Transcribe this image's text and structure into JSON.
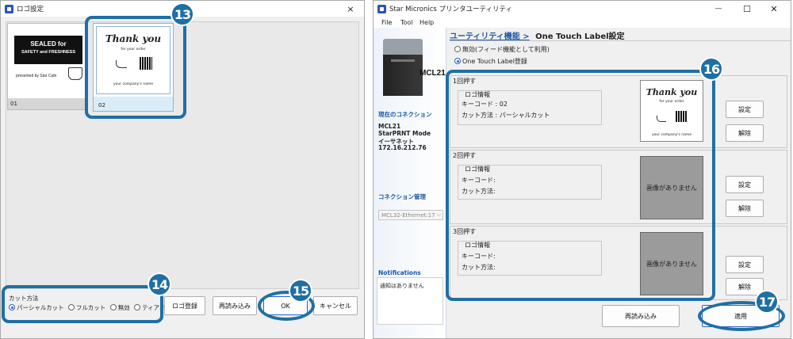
{
  "left_window": {
    "title": "ロゴ設定",
    "close": "×",
    "logos": [
      {
        "index": "01",
        "line1": "SEALED for",
        "line2": "SAFETY and FRESHNESS",
        "line3": "presented by Star Cafe"
      },
      {
        "index": "02",
        "title": "Thank you",
        "line1": "for your order",
        "line2": "your company's name"
      }
    ],
    "cut_method": {
      "label": "カット方法",
      "options": [
        "パーシャルカット",
        "フルカット",
        "無効",
        "ティアオフ"
      ],
      "selected": "パーシャルカット"
    },
    "buttons": {
      "register": "ロゴ登録",
      "reload": "再読み込み",
      "ok": "OK",
      "cancel": "キャンセル"
    }
  },
  "right_window": {
    "title": "Star Micronics プリンタユーティリティ",
    "controls": {
      "minimize": "—",
      "maximize": "☐",
      "close": "✕"
    },
    "menu": [
      "File",
      "Tool",
      "Help"
    ],
    "breadcrumb": {
      "parent": "ユーティリティ機能 >",
      "current": "One Touch Label設定"
    },
    "mode_options": [
      {
        "label": "無効(フィード機能として利用)",
        "selected": false
      },
      {
        "label": "One Touch Label登録",
        "selected": true
      }
    ],
    "printer": {
      "model_label": "MCL21"
    },
    "sidebar": {
      "conn_title": "現在のコネクション",
      "conn_lines": [
        "MCL21",
        "StarPRNT Mode",
        "イーサネット",
        "172.16.212.76"
      ],
      "conn_mgmt": "コネクション管理",
      "conn_select": "MCL32-Ethernet:17",
      "notif_title": "Notifications",
      "notif_text": "通知はありません"
    },
    "presses": [
      {
        "header": "1回押す",
        "info_title": "ロゴ情報",
        "key_code": "キーコード : 02",
        "cut": "カット方法 : パーシャルカット",
        "has_image": true
      },
      {
        "header": "2回押す",
        "info_title": "ロゴ情報",
        "key_code": "キーコード:",
        "cut": "カット方法:",
        "has_image": false,
        "no_image": "画像がありません"
      },
      {
        "header": "3回押す",
        "info_title": "ロゴ情報",
        "key_code": "キーコード:",
        "cut": "カット方法:",
        "has_image": false,
        "no_image": "画像がありません"
      }
    ],
    "preview": {
      "title": "Thank you",
      "line1": "for your order",
      "line2": "your company's name"
    },
    "side_buttons": {
      "set": "設定",
      "clear": "解除"
    },
    "bottom_buttons": {
      "reload": "再読み込み",
      "apply": "適用"
    }
  },
  "badges": [
    "13",
    "14",
    "15",
    "16",
    "17"
  ],
  "accent": "#1f6fa4"
}
